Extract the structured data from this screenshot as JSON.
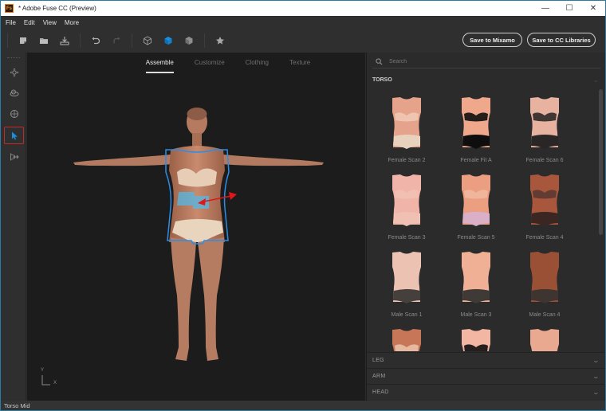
{
  "window": {
    "title": "* Adobe Fuse CC (Preview)",
    "app_icon_label": "Fs",
    "controls": {
      "minimize": "—",
      "maximize": "☐",
      "close": "✕"
    }
  },
  "menu": {
    "items": [
      "File",
      "Edit",
      "View",
      "More"
    ]
  },
  "toolbar": {
    "icons": [
      "new-icon",
      "open-folder-icon",
      "export-icon",
      "undo-icon",
      "redo-icon",
      "wireframe-cube-icon",
      "shaded-cube-icon",
      "solid-cube-icon",
      "favorite-star-icon"
    ],
    "save_mixamo": "Save to Mixamo",
    "save_cc": "Save to CC Libraries",
    "accent_color": "#1a8fe0"
  },
  "rail": {
    "tools": [
      "move-tool",
      "rotate-tool",
      "orbit-tool",
      "select-tool",
      "pose-tool"
    ],
    "active_tool": "select-tool"
  },
  "viewport": {
    "tabs": [
      {
        "label": "Assemble",
        "active": true
      },
      {
        "label": "Customize",
        "active": false
      },
      {
        "label": "Clothing",
        "active": false
      },
      {
        "label": "Texture",
        "active": false
      }
    ],
    "axis": {
      "y": "Y",
      "x": "X"
    },
    "selection_color": "#2a8ee8",
    "drag_arrow_color": "#e0161a"
  },
  "panel": {
    "search_placeholder": "Search",
    "torso_label": "TORSO",
    "torso_items": [
      {
        "name": "Female Scan 2",
        "skin": "#e6a38c",
        "wear": "#e9d2bd",
        "wear_top": "#f0c9b6"
      },
      {
        "name": "Female Fit A",
        "skin": "#efa88c",
        "wear": "#0e0e0e",
        "wear_top": "#0e0e0e"
      },
      {
        "name": "Female Scan 6",
        "skin": "#e7b3a0",
        "wear": "#2a2626",
        "wear_top": "#2e2828"
      },
      {
        "name": "Female Scan 3",
        "skin": "#f0b5a8",
        "wear": "#f0c0b3",
        "wear_top": "#f2c0b4"
      },
      {
        "name": "Female Scan 5",
        "skin": "#ec9f80",
        "wear": "#dab0c8",
        "wear_top": "#f0b8a0"
      },
      {
        "name": "Female Scan 4",
        "skin": "#a8573c",
        "wear": "#3a2622",
        "wear_top": "#5a3a32"
      },
      {
        "name": "Male Scan 1",
        "skin": "#ecc2b2",
        "wear": "#45403c",
        "wear_top": "#ecc2b2"
      },
      {
        "name": "Male Scan 3",
        "skin": "#f0b096",
        "wear": "#403a36",
        "wear_top": "#f0b096"
      },
      {
        "name": "Male Scan 4",
        "skin": "#9a5035",
        "wear": "#3e3430",
        "wear_top": "#9a5035"
      },
      {
        "name": "",
        "skin": "#c87658",
        "wear": "#e9c0a8",
        "wear_top": "#e9c0a8"
      },
      {
        "name": "",
        "skin": "#f2b6a2",
        "wear": "#0e0e0e",
        "wear_top": "#0e0e0e"
      },
      {
        "name": "",
        "skin": "#e9a890",
        "wear": "#e9a890",
        "wear_top": "#e9a890"
      }
    ],
    "collapsed_sections": [
      "LEG",
      "ARM",
      "HEAD"
    ]
  },
  "status": {
    "text": "Torso Mid"
  }
}
